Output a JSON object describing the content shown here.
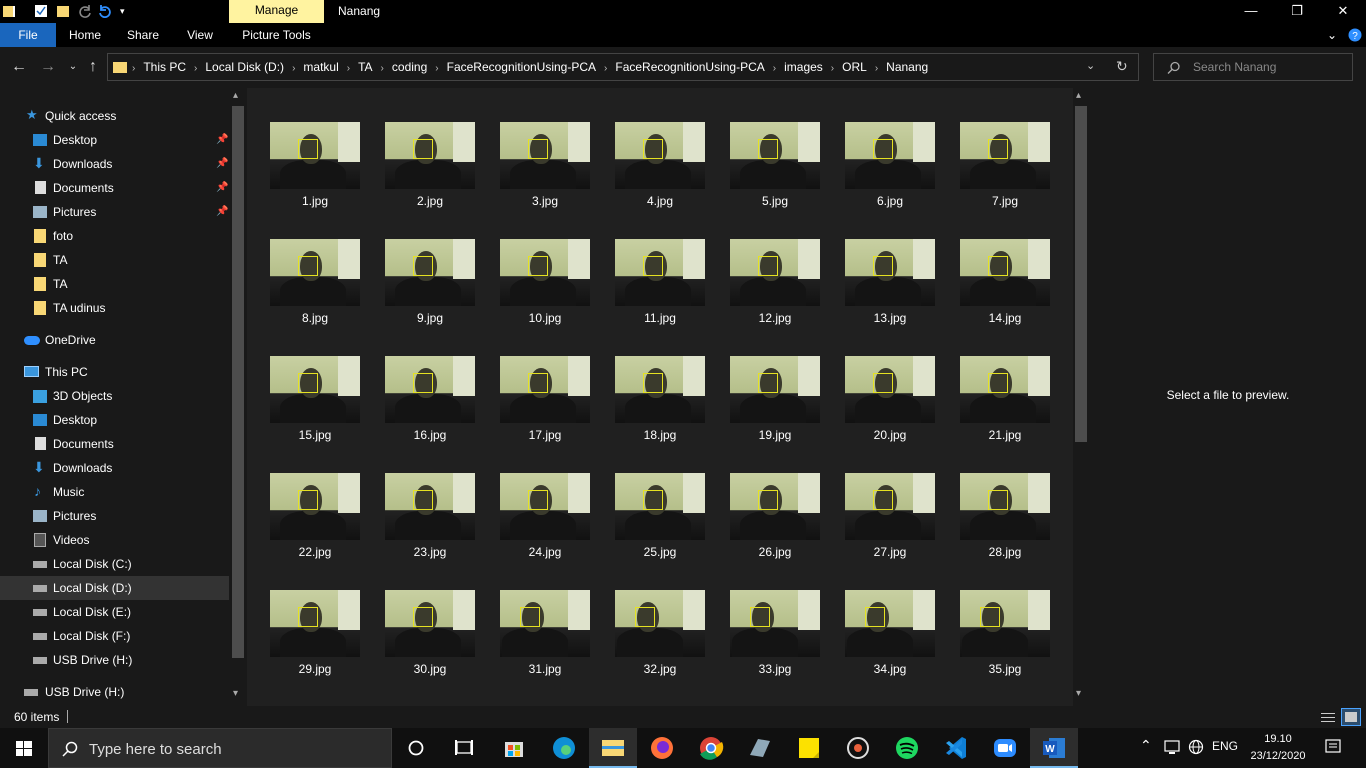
{
  "titlebar": {
    "manage_tab": "Manage",
    "window_title": "Nanang"
  },
  "ribbon": {
    "tabs": [
      "File",
      "Home",
      "Share",
      "View",
      "Picture Tools"
    ]
  },
  "address": {
    "crumbs": [
      "This PC",
      "Local Disk (D:)",
      "matkul",
      "TA",
      "coding",
      "FaceRecognitionUsing-PCA",
      "FaceRecognitionUsing-PCA",
      "images",
      "ORL",
      "Nanang"
    ]
  },
  "search": {
    "placeholder": "Search Nanang"
  },
  "sidebar": {
    "quick_access": "Quick access",
    "quick_items": [
      "Desktop",
      "Downloads",
      "Documents",
      "Pictures",
      "foto",
      "TA",
      "TA",
      "TA udinus"
    ],
    "onedrive": "OneDrive",
    "this_pc": "This PC",
    "pc_items": [
      "3D Objects",
      "Desktop",
      "Documents",
      "Downloads",
      "Music",
      "Pictures",
      "Videos",
      "Local Disk (C:)",
      "Local Disk (D:)",
      "Local Disk (E:)",
      "Local Disk (F:)",
      "USB Drive (H:)"
    ],
    "usb": "USB Drive (H:)"
  },
  "files": [
    "1.jpg",
    "2.jpg",
    "3.jpg",
    "4.jpg",
    "5.jpg",
    "6.jpg",
    "7.jpg",
    "8.jpg",
    "9.jpg",
    "10.jpg",
    "11.jpg",
    "12.jpg",
    "13.jpg",
    "14.jpg",
    "15.jpg",
    "16.jpg",
    "17.jpg",
    "18.jpg",
    "19.jpg",
    "20.jpg",
    "21.jpg",
    "22.jpg",
    "23.jpg",
    "24.jpg",
    "25.jpg",
    "26.jpg",
    "27.jpg",
    "28.jpg",
    "29.jpg",
    "30.jpg",
    "31.jpg",
    "32.jpg",
    "33.jpg",
    "34.jpg",
    "35.jpg"
  ],
  "preview": {
    "text": "Select a file to preview."
  },
  "status": {
    "count": "60 items"
  },
  "taskbar": {
    "search_placeholder": "Type here to search",
    "lang": "ENG",
    "time": "19.10",
    "date": "23/12/2020"
  },
  "colors": {
    "file_tab": "#1a66bd",
    "manage_tab": "#fff3a0",
    "folder": "#f8d775",
    "facebox": "#e5e222"
  }
}
